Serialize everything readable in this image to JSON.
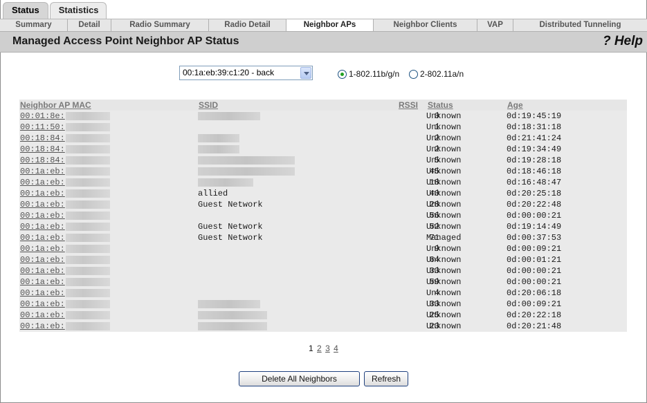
{
  "top_tabs": [
    {
      "label": "Status"
    },
    {
      "label": "Statistics"
    }
  ],
  "sub_tabs": [
    {
      "label": "Summary"
    },
    {
      "label": "Detail"
    },
    {
      "label": "Radio Summary"
    },
    {
      "label": "Radio Detail"
    },
    {
      "label": "Neighbor APs"
    },
    {
      "label": "Neighbor Clients"
    },
    {
      "label": "VAP"
    },
    {
      "label": "Distributed Tunneling"
    }
  ],
  "header": {
    "title": "Managed Access Point Neighbor AP Status",
    "help_label": "? Help"
  },
  "controls": {
    "ap_select_value": "00:1a:eb:39:c1:20 - back",
    "radio_1_label": "1-802.11b/g/n",
    "radio_2_label": "2-802.11a/n",
    "radio_selected": "1-802.11b/g/n"
  },
  "table": {
    "headers": {
      "mac": "Neighbor AP MAC",
      "ssid": "SSID",
      "rssi": "RSSI",
      "status": "Status",
      "age": "Age"
    },
    "rows": [
      {
        "mac": "00:01:8e:",
        "ssid": "",
        "ssid_blur": true,
        "rssi": "0",
        "status": "Unknown",
        "age": "0d:19:45:19"
      },
      {
        "mac": "00:11:50:",
        "ssid": "",
        "ssid_blur": false,
        "rssi": "1",
        "status": "Unknown",
        "age": "0d:18:31:18"
      },
      {
        "mac": "00:18:84:",
        "ssid": "",
        "ssid_blur": true,
        "rssi": "2",
        "status": "Unknown",
        "age": "0d:21:41:24"
      },
      {
        "mac": "00:18:84:",
        "ssid": "",
        "ssid_blur": true,
        "rssi": "2",
        "status": "Unknown",
        "age": "0d:19:34:49"
      },
      {
        "mac": "00:18:84:",
        "ssid": "",
        "ssid_blur": true,
        "rssi": "5",
        "status": "Unknown",
        "age": "0d:19:28:18"
      },
      {
        "mac": "00:1a:eb:",
        "ssid": "",
        "ssid_blur": true,
        "rssi": "45",
        "status": "Unknown",
        "age": "0d:18:46:18"
      },
      {
        "mac": "00:1a:eb:",
        "ssid": "",
        "ssid_blur": true,
        "rssi": "18",
        "status": "Unknown",
        "age": "0d:16:48:47"
      },
      {
        "mac": "00:1a:eb:",
        "ssid": "allied",
        "ssid_blur": false,
        "rssi": "40",
        "status": "Unknown",
        "age": "0d:20:25:18"
      },
      {
        "mac": "00:1a:eb:",
        "ssid": "Guest Network",
        "ssid_blur": false,
        "rssi": "28",
        "status": "Unknown",
        "age": "0d:20:22:48"
      },
      {
        "mac": "00:1a:eb:",
        "ssid": "",
        "ssid_blur": false,
        "rssi": "56",
        "status": "Unknown",
        "age": "0d:00:00:21"
      },
      {
        "mac": "00:1a:eb:",
        "ssid": "Guest Network",
        "ssid_blur": false,
        "rssi": "52",
        "status": "Unknown",
        "age": "0d:19:14:49"
      },
      {
        "mac": "00:1a:eb:",
        "ssid": "Guest Network",
        "ssid_blur": false,
        "rssi": "71",
        "status": "Managed",
        "age": "0d:00:37:53"
      },
      {
        "mac": "00:1a:eb:",
        "ssid": "",
        "ssid_blur": false,
        "rssi": "9",
        "status": "Unknown",
        "age": "0d:00:09:21"
      },
      {
        "mac": "00:1a:eb:",
        "ssid": "",
        "ssid_blur": false,
        "rssi": "64",
        "status": "Unknown",
        "age": "0d:00:01:21"
      },
      {
        "mac": "00:1a:eb:",
        "ssid": "",
        "ssid_blur": false,
        "rssi": "33",
        "status": "Unknown",
        "age": "0d:00:00:21"
      },
      {
        "mac": "00:1a:eb:",
        "ssid": "",
        "ssid_blur": false,
        "rssi": "59",
        "status": "Unknown",
        "age": "0d:00:00:21"
      },
      {
        "mac": "00:1a:eb:",
        "ssid": "",
        "ssid_blur": false,
        "rssi": "4",
        "status": "Unknown",
        "age": "0d:20:06:18"
      },
      {
        "mac": "00:1a:eb:",
        "ssid": "",
        "ssid_blur": true,
        "rssi": "33",
        "status": "Unknown",
        "age": "0d:00:09:21"
      },
      {
        "mac": "00:1a:eb:",
        "ssid": "",
        "ssid_blur": true,
        "rssi": "25",
        "status": "Unknown",
        "age": "0d:20:22:18"
      },
      {
        "mac": "00:1a:eb:",
        "ssid": "",
        "ssid_blur": true,
        "rssi": "23",
        "status": "Unknown",
        "age": "0d:20:21:48"
      }
    ]
  },
  "pagination": {
    "current": "1",
    "pages": [
      "2",
      "3",
      "4"
    ]
  },
  "buttons": {
    "delete_all": "Delete All Neighbors",
    "refresh": "Refresh"
  }
}
